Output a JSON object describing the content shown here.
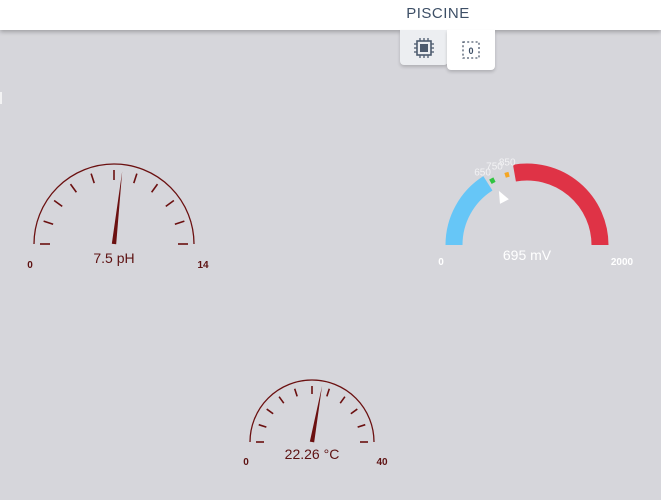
{
  "header": {
    "title": "PISCINE"
  },
  "tabs": [
    {
      "icon": "cpu-chip-icon",
      "active": true
    },
    {
      "icon": "counter-box-icon",
      "label": "0",
      "active": false
    }
  ],
  "colors": {
    "gauge_dark": "#6b1010",
    "orp_low": "#66c6f7",
    "orp_high": "#df3346",
    "orp_green": "#31c441",
    "orp_orange": "#f5a623"
  },
  "gauges": {
    "ph": {
      "value": 7.5,
      "min": 0,
      "max": 14,
      "display": "7.5 pH",
      "min_label": "0",
      "max_label": "14"
    },
    "orp": {
      "value": 695,
      "min": 0,
      "max": 2000,
      "display": "695 mV",
      "min_label": "0",
      "max_label": "2000",
      "thresholds": [
        "650",
        "750",
        "850"
      ]
    },
    "temp": {
      "value": 22.26,
      "min": 0,
      "max": 40,
      "display": "22.26 °C",
      "min_label": "0",
      "max_label": "40"
    }
  }
}
